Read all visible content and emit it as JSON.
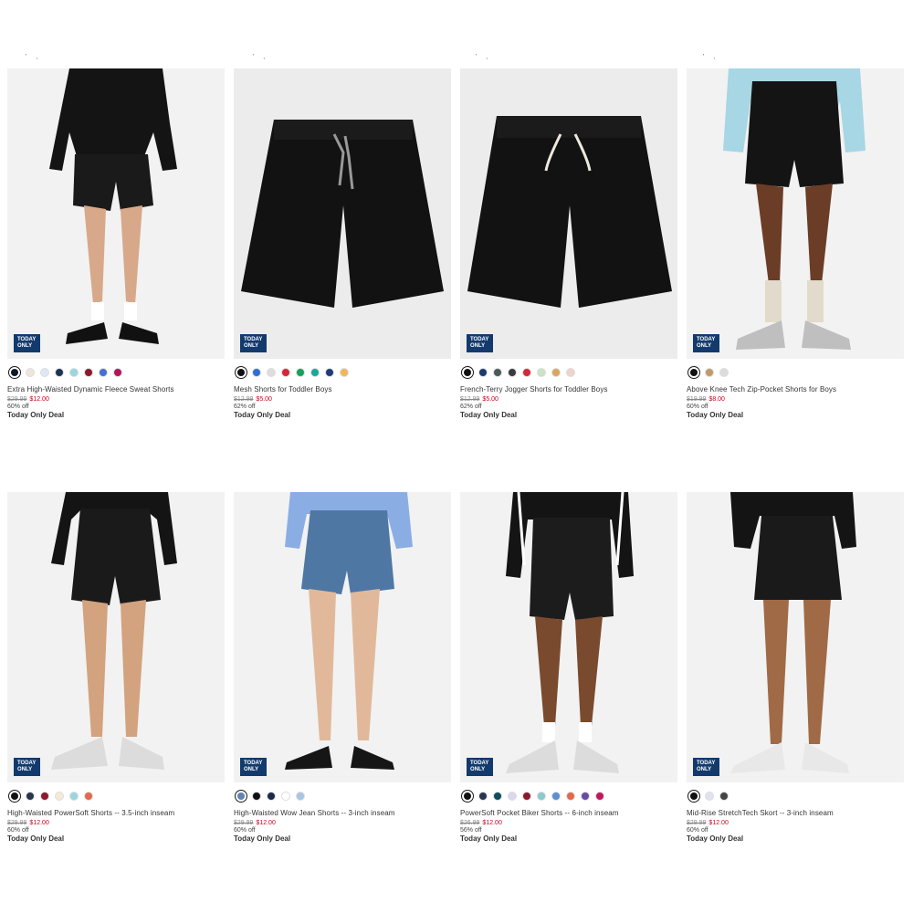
{
  "badge": "TODAY ONLY",
  "products": [
    {
      "name": "Extra High-Waisted Dynamic Fleece Sweat Shorts",
      "old_price": "$29.99",
      "new_price": "$12.00",
      "discount": "60% off",
      "deal": "Today Only Deal",
      "swatches": [
        "#0d1a2b",
        "#efe5dc",
        "#dfe7f5",
        "#1d3454",
        "#9ad6e0",
        "#8a1a2c",
        "#4a6fd4",
        "#b0165a"
      ]
    },
    {
      "name": "Mesh Shorts for Toddler Boys",
      "old_price": "$12.99",
      "new_price": "$5.00",
      "discount": "62% off",
      "deal": "Today Only Deal",
      "swatches": [
        "#111111",
        "#2f6fd4",
        "#dddddd",
        "#d6263a",
        "#19a05a",
        "#17a89a",
        "#1f3c7a",
        "#f0b75a"
      ]
    },
    {
      "name": "French-Terry Jogger Shorts for Toddler Boys",
      "old_price": "$12.99",
      "new_price": "$5.00",
      "discount": "62% off",
      "deal": "Today Only Deal",
      "swatches": [
        "#111111",
        "#1d3a6e",
        "#4b5a5a",
        "#3a3a3a",
        "#d6263a",
        "#c9e3c4",
        "#d9a85c",
        "#f2d2c8"
      ]
    },
    {
      "name": "Above Knee Tech Zip-Pocket Shorts for Boys",
      "old_price": "$19.99",
      "new_price": "$8.00",
      "discount": "60% off",
      "deal": "Today Only Deal",
      "swatches": [
        "#111111",
        "#c29a6a",
        "#dcdcdc"
      ]
    },
    {
      "name": "High-Waisted PowerSoft Shorts -- 3.5-inch inseam",
      "old_price": "$29.99",
      "new_price": "$12.00",
      "discount": "60% off",
      "deal": "Today Only Deal",
      "swatches": [
        "#111111",
        "#2b3550",
        "#8a1a2c",
        "#f5ead6",
        "#9ad6e0",
        "#e06a4e"
      ]
    },
    {
      "name": "High-Waisted Wow Jean Shorts -- 3-inch inseam",
      "old_price": "$29.99",
      "new_price": "$12.00",
      "discount": "60% off",
      "deal": "Today Only Deal",
      "swatches": [
        "#5f84b0",
        "#111111",
        "#1c2a4a",
        "#ffffff",
        "#a8c6e3"
      ]
    },
    {
      "name": "PowerSoft Pocket Biker Shorts -- 6-inch inseam",
      "old_price": "$26.99",
      "new_price": "$12.00",
      "discount": "56% off",
      "deal": "Today Only Deal",
      "swatches": [
        "#111111",
        "#2b3550",
        "#0f4d5a",
        "#dcd6ef",
        "#8a1a2c",
        "#8ec9cc",
        "#5b8fd4",
        "#e06a4e",
        "#6a4aa3",
        "#c2185b"
      ]
    },
    {
      "name": "Mid-Rise StretchTech Skort -- 3-inch inseam",
      "old_price": "$29.99",
      "new_price": "$12.00",
      "discount": "60% off",
      "deal": "Today Only Deal",
      "swatches": [
        "#111111",
        "#dfe2f0",
        "#444444"
      ]
    }
  ]
}
